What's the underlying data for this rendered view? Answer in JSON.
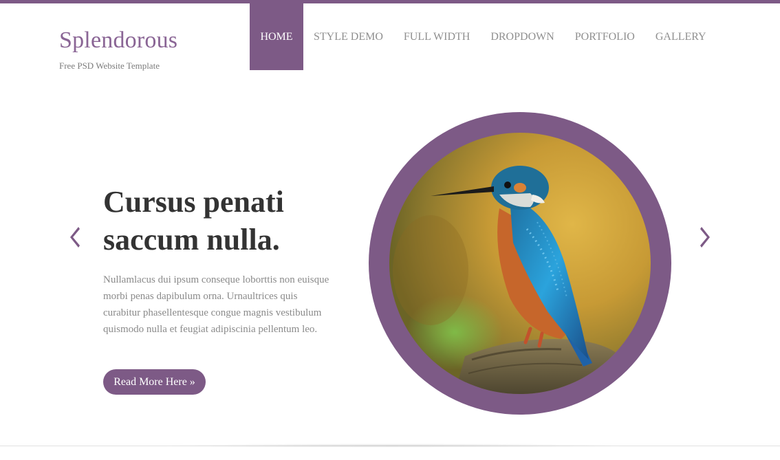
{
  "brand": {
    "title": "Splendorous",
    "tagline": "Free PSD Website Template",
    "accent_color": "#7d5a86"
  },
  "nav": {
    "items": [
      {
        "label": "HOME",
        "active": true
      },
      {
        "label": "STYLE DEMO",
        "active": false
      },
      {
        "label": "FULL WIDTH",
        "active": false
      },
      {
        "label": "DROPDOWN",
        "active": false
      },
      {
        "label": "PORTFOLIO",
        "active": false
      },
      {
        "label": "GALLERY",
        "active": false
      }
    ]
  },
  "slider": {
    "headline": "Cursus penati saccum nulla.",
    "body": "Nullamlacus dui ipsum conseque loborttis non euisque morbi penas dapibulum orna. Urnaultrices quis curabitur phasellentesque congue magnis vestibulum quismodo nulla et feugiat adipiscinia pellentum leo.",
    "cta_label": "Read More Here »",
    "prev_icon": "chevron-left-icon",
    "next_icon": "chevron-right-icon",
    "image": "kingfisher-bird-photo"
  }
}
